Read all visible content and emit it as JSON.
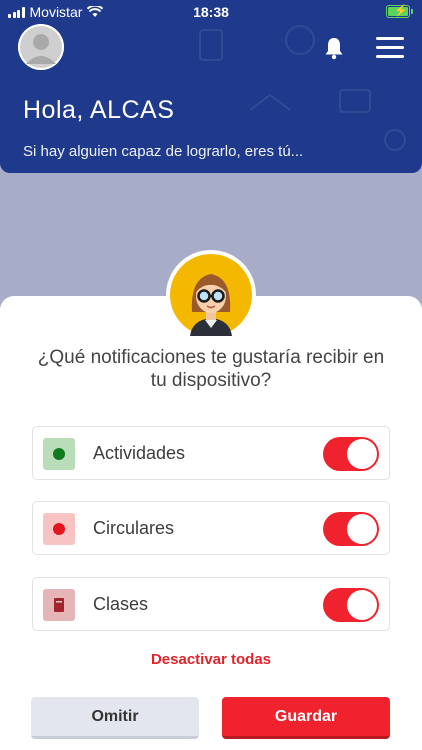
{
  "status_bar": {
    "carrier": "Movistar",
    "time": "18:38"
  },
  "header": {
    "greeting": "Hola, ALCAS",
    "subtitle": "Si hay alguien capaz de lograrlo, eres tú..."
  },
  "icons": {
    "avatar": "user-avatar-icon",
    "bell": "bell-icon",
    "menu": "hamburger-menu-icon",
    "mascot": "girl-with-glasses-avatar"
  },
  "question": "¿Qué notificaciones te gustaría recibir en tu dispositivo?",
  "options": [
    {
      "label": "Actividades",
      "icon": "green-dot-icon",
      "enabled": true
    },
    {
      "label": "Circulares",
      "icon": "red-dot-icon",
      "enabled": true
    },
    {
      "label": "Clases",
      "icon": "book-icon",
      "enabled": true
    }
  ],
  "deactivate_all": "Desactivar todas",
  "buttons": {
    "skip": "Omitir",
    "save": "Guardar"
  },
  "colors": {
    "header": "#1f3a8c",
    "accent": "#f0222e",
    "background": "#a7acc9",
    "green": "#0f7a1e"
  }
}
